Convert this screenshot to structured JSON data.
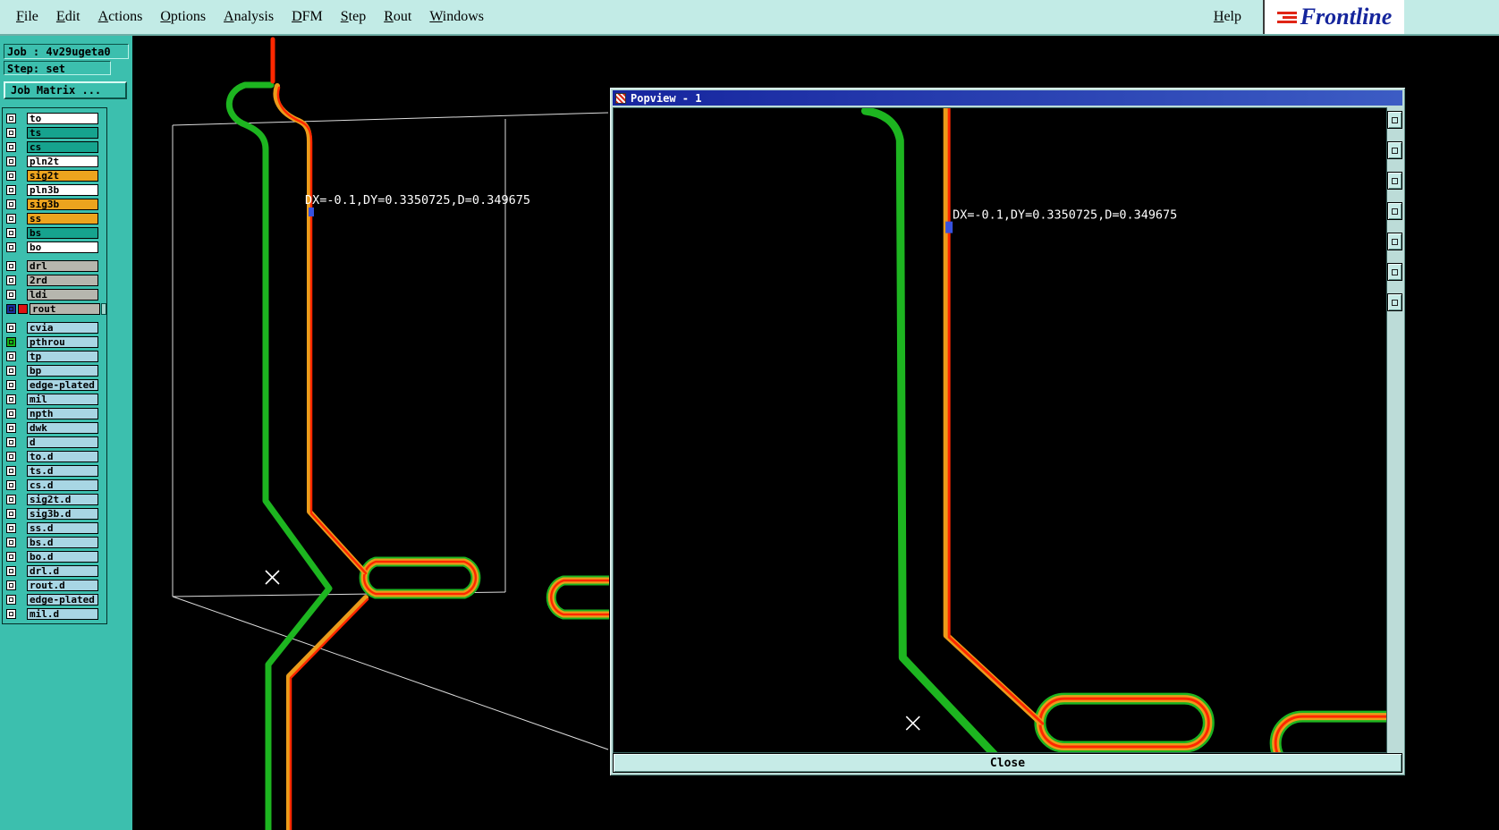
{
  "menu": {
    "items": [
      "File",
      "Edit",
      "Actions",
      "Options",
      "Analysis",
      "DFM",
      "Step",
      "Rout",
      "Windows"
    ],
    "help_label": "Help",
    "logo_text": "Frontline"
  },
  "sidebar": {
    "job_label": "Job : 4v29ugeta0",
    "step_label": "Step: set",
    "job_matrix_button": "Job Matrix ...",
    "group_breaks": [
      9,
      13
    ],
    "layers": [
      {
        "name": "to",
        "color": "#ffffff"
      },
      {
        "name": "ts",
        "color": "#16a38e"
      },
      {
        "name": "cs",
        "color": "#16a38e"
      },
      {
        "name": "pln2t",
        "color": "#ffffff"
      },
      {
        "name": "sig2t",
        "color": "#eca41e"
      },
      {
        "name": "pln3b",
        "color": "#ffffff"
      },
      {
        "name": "sig3b",
        "color": "#eca41e"
      },
      {
        "name": "ss",
        "color": "#eca41e"
      },
      {
        "name": "bs",
        "color": "#16a38e"
      },
      {
        "name": "bo",
        "color": "#ffffff"
      },
      {
        "name": "drl",
        "color": "#b6b6ae"
      },
      {
        "name": "2rd",
        "color": "#b6b6ae"
      },
      {
        "name": "ldi",
        "color": "#b6b6ae"
      },
      {
        "name": "rout",
        "color": "#b6b6ae",
        "checkbox_color": "#1a2fa0",
        "indicator_color": "#dd1111",
        "has_handle": true
      },
      {
        "name": "cvia",
        "color": "#a8d6e4"
      },
      {
        "name": "pthrou",
        "color": "#a8d6e4",
        "checkbox_color": "#15b415"
      },
      {
        "name": "tp",
        "color": "#a8d6e4"
      },
      {
        "name": "bp",
        "color": "#a8d6e4"
      },
      {
        "name": "edge-plated",
        "color": "#a8d6e4"
      },
      {
        "name": "mil",
        "color": "#a8d6e4"
      },
      {
        "name": "npth",
        "color": "#a8d6e4"
      },
      {
        "name": "dwk",
        "color": "#a8d6e4"
      },
      {
        "name": "d",
        "color": "#a8d6e4"
      },
      {
        "name": "to.d",
        "color": "#a8d6e4"
      },
      {
        "name": "ts.d",
        "color": "#a8d6e4"
      },
      {
        "name": "cs.d",
        "color": "#a8d6e4"
      },
      {
        "name": "sig2t.d",
        "color": "#a8d6e4"
      },
      {
        "name": "sig3b.d",
        "color": "#a8d6e4"
      },
      {
        "name": "ss.d",
        "color": "#a8d6e4"
      },
      {
        "name": "bs.d",
        "color": "#a8d6e4"
      },
      {
        "name": "bo.d",
        "color": "#a8d6e4"
      },
      {
        "name": "drl.d",
        "color": "#a8d6e4"
      },
      {
        "name": "rout.d",
        "color": "#a8d6e4"
      },
      {
        "name": "edge-plated",
        "color": "#a8d6e4"
      },
      {
        "name": "mil.d",
        "color": "#a8d6e4"
      }
    ]
  },
  "main_canvas": {
    "measure_text": "DX=-0.1,DY=0.3350725,D=0.349675"
  },
  "popup": {
    "title": "Popview - 1",
    "measure_text": "DX=-0.1,DY=0.3350725,D=0.349675",
    "close_button": "Close",
    "tool_buttons": [
      "popview-tool-1",
      "popview-tool-2",
      "popview-tool-3",
      "popview-tool-4",
      "popview-tool-5",
      "popview-tool-6",
      "popview-tool-7"
    ]
  },
  "colors": {
    "desktop_teal": "#3cbfae",
    "menu_bg": "#c2ebe6",
    "trace_green": "#1db520",
    "trace_orange": "#eb9c1a",
    "trace_red": "#ff2800",
    "titlebar_blue": "#16259e"
  }
}
